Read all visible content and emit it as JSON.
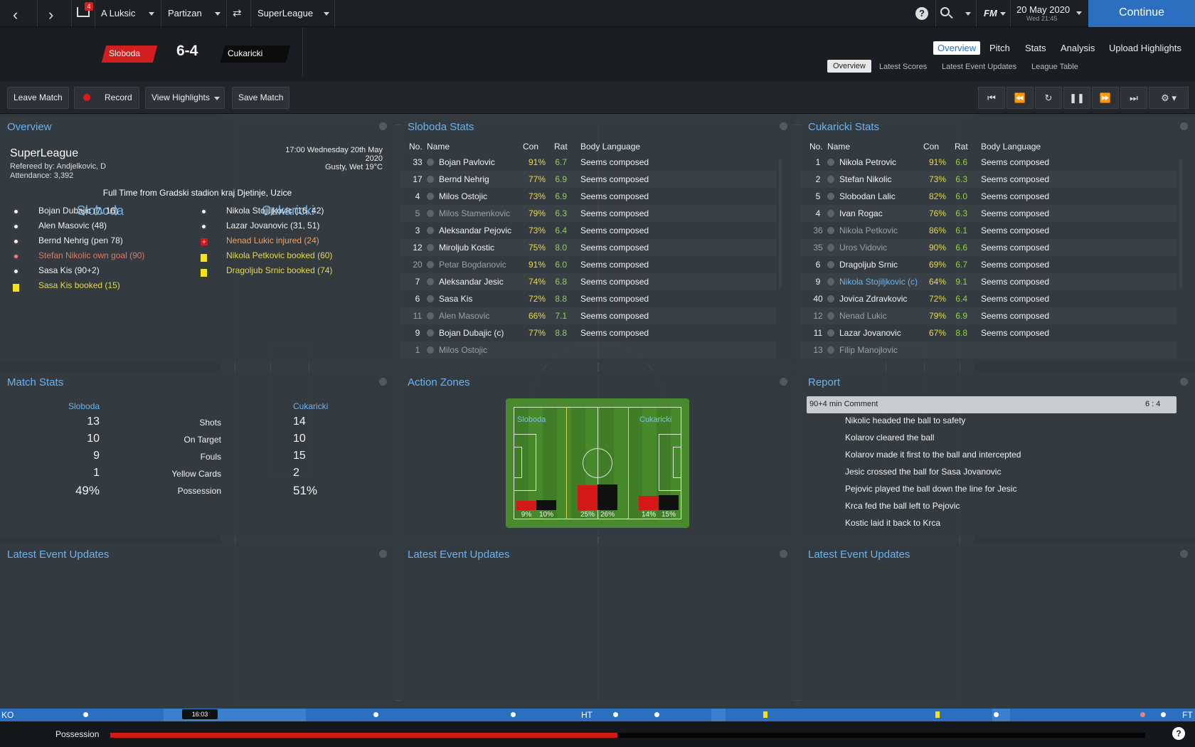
{
  "topbar": {
    "manager": "A Luksic",
    "club": "Partizan",
    "competition": "SuperLeague",
    "inbox_count": "4",
    "date": "20 May 2020",
    "time": "Wed 21:45",
    "fm_logo": "FM",
    "continue": "Continue",
    "help": "?"
  },
  "score": {
    "home": "Sloboda",
    "away": "Cukaricki",
    "score": "6-4",
    "home_color": "#d11f1f",
    "away_color": "#111111"
  },
  "tabs": {
    "main": [
      "Overview",
      "Pitch",
      "Stats",
      "Analysis",
      "Upload Highlights"
    ],
    "sub": [
      "Overview",
      "Latest Scores",
      "Latest Event Updates",
      "League Table"
    ]
  },
  "toolbar": {
    "leave": "Leave Match",
    "record": "Record",
    "highlights": "View Highlights",
    "save": "Save Match"
  },
  "overview": {
    "title": "Overview",
    "league": "SuperLeague",
    "referee": "Refereed by: Andjelkovic, D",
    "attendance": "Attendance: 3,392",
    "datetime": "17:00 Wednesday 20th May",
    "year": "2020",
    "weather": "Gusty, Wet 19°C",
    "fulltime": "Full Time from Gradski stadion kraj Djetinje, Uzice",
    "home": "Sloboda",
    "away": "Cukaricki",
    "home_events": [
      {
        "icon": "ball",
        "text": "Bojan Dubajic (7, 16)",
        "tone": "wht"
      },
      {
        "icon": "ball",
        "text": "Alen Masovic (48)",
        "tone": "wht"
      },
      {
        "icon": "ball",
        "text": "Bernd Nehrig (pen 78)",
        "tone": "wht"
      },
      {
        "icon": "ball-red",
        "text": "Stefan Nikolic own goal (90)",
        "tone": "red"
      },
      {
        "icon": "ball",
        "text": "Sasa Kis (90+2)",
        "tone": "wht"
      },
      {
        "icon": "ycard",
        "text": "Sasa Kis booked (15)",
        "tone": "yel"
      }
    ],
    "away_events": [
      {
        "icon": "ball",
        "text": "Nikola Stojiljkovic (16, 42)",
        "tone": "wht"
      },
      {
        "icon": "ball",
        "text": "Lazar Jovanovic (31, 51)",
        "tone": "wht"
      },
      {
        "icon": "injury",
        "text": "Nenad Lukic injured (24)",
        "tone": "org"
      },
      {
        "icon": "ycard",
        "text": "Nikola Petkovic booked (60)",
        "tone": "yel"
      },
      {
        "icon": "ycard",
        "text": "Dragoljub Srnic booked (74)",
        "tone": "yel"
      }
    ]
  },
  "home_stats": {
    "title": "Sloboda Stats",
    "headers": [
      "No.",
      "Name",
      "Con",
      "Rat",
      "Body Language"
    ],
    "rows": [
      [
        "33",
        "Bojan Pavlovic",
        "91%",
        "6.7",
        "Seems composed",
        "wht"
      ],
      [
        "17",
        "Bernd Nehrig",
        "77%",
        "6.9",
        "Seems composed",
        "wht"
      ],
      [
        "4",
        "Milos Ostojic",
        "73%",
        "6.9",
        "Seems composed",
        "wht"
      ],
      [
        "5",
        "Milos Stamenkovic",
        "79%",
        "6.3",
        "Seems composed",
        "gry"
      ],
      [
        "3",
        "Aleksandar Pejovic",
        "73%",
        "6.4",
        "Seems composed",
        "wht"
      ],
      [
        "12",
        "Miroljub Kostic",
        "75%",
        "8.0",
        "Seems composed",
        "wht"
      ],
      [
        "20",
        "Petar Bogdanovic",
        "91%",
        "6.0",
        "Seems composed",
        "gry"
      ],
      [
        "7",
        "Aleksandar Jesic",
        "74%",
        "6.8",
        "Seems composed",
        "wht"
      ],
      [
        "6",
        "Sasa Kis",
        "72%",
        "8.8",
        "Seems composed",
        "wht"
      ],
      [
        "11",
        "Alen Masovic",
        "66%",
        "7.1",
        "Seems composed",
        "gry"
      ],
      [
        "9",
        "Bojan Dubajic (c)",
        "77%",
        "8.8",
        "Seems composed",
        "wht"
      ],
      [
        "1",
        "Milos Ostojic",
        "",
        "",
        "",
        "gry"
      ]
    ]
  },
  "away_stats": {
    "title": "Cukaricki Stats",
    "headers": [
      "No.",
      "Name",
      "Con",
      "Rat",
      "Body Language"
    ],
    "rows": [
      [
        "1",
        "Nikola Petrovic",
        "91%",
        "6.6",
        "Seems composed",
        "wht"
      ],
      [
        "2",
        "Stefan Nikolic",
        "73%",
        "6.3",
        "Seems composed",
        "wht"
      ],
      [
        "5",
        "Slobodan Lalic",
        "82%",
        "6.0",
        "Seems composed",
        "wht"
      ],
      [
        "4",
        "Ivan Rogac",
        "76%",
        "6.3",
        "Seems composed",
        "wht"
      ],
      [
        "36",
        "Nikola Petkovic",
        "86%",
        "6.1",
        "Seems composed",
        "gry"
      ],
      [
        "35",
        "Uros Vidovic",
        "90%",
        "6.6",
        "Seems composed",
        "gry"
      ],
      [
        "6",
        "Dragoljub Srnic",
        "69%",
        "6.7",
        "Seems composed",
        "wht"
      ],
      [
        "9",
        "Nikola Stojiljkovic (c)",
        "64%",
        "9.1",
        "Seems composed",
        "blu"
      ],
      [
        "40",
        "Jovica Zdravkovic",
        "72%",
        "6.4",
        "Seems composed",
        "wht"
      ],
      [
        "12",
        "Nenad Lukic",
        "79%",
        "6.9",
        "Seems composed",
        "gry"
      ],
      [
        "11",
        "Lazar Jovanovic",
        "67%",
        "8.8",
        "Seems composed",
        "wht"
      ],
      [
        "13",
        "Filip Manojlovic",
        "",
        "",
        "",
        "gry"
      ]
    ]
  },
  "match_stats": {
    "title": "Match Stats",
    "home": "Sloboda",
    "away": "Cukaricki",
    "rows": [
      [
        "13",
        "Shots",
        "14"
      ],
      [
        "10",
        "On Target",
        "10"
      ],
      [
        "9",
        "Fouls",
        "15"
      ],
      [
        "1",
        "Yellow Cards",
        "2"
      ],
      [
        "49%",
        "Possession",
        "51%"
      ]
    ]
  },
  "action_zones": {
    "title": "Action Zones",
    "home": "Sloboda",
    "away": "Cukaricki",
    "zones": [
      {
        "home": 9,
        "away": 10,
        "home_label": "9%",
        "away_label": "10%"
      },
      {
        "home": 25,
        "away": 26,
        "home_label": "25%",
        "away_label": "26%"
      },
      {
        "home": 14,
        "away": 15,
        "home_label": "14%",
        "away_label": "15%"
      }
    ]
  },
  "report": {
    "title": "Report",
    "comment_header": "90+4 min Comment",
    "comment_score": "6 : 4",
    "lines": [
      "Nikolic headed the ball to safety",
      "Kolarov cleared the ball",
      "Kolarov made it first to the ball and intercepted",
      "Jesic crossed the ball for Sasa Jovanovic",
      "Pejovic played the ball down the line for Jesic",
      "Krca fed the ball left to Pejovic",
      "Kostic laid it back to Krca"
    ]
  },
  "latest": {
    "title1": "Latest Event Updates",
    "title2": "Latest Event Updates",
    "title3": "Latest Event Updates"
  },
  "timeline": {
    "ko": "KO",
    "ht": "HT",
    "ft": "FT",
    "marker_time": "16:03"
  },
  "possession": {
    "label": "Possession",
    "home_fraction": 0.49
  }
}
